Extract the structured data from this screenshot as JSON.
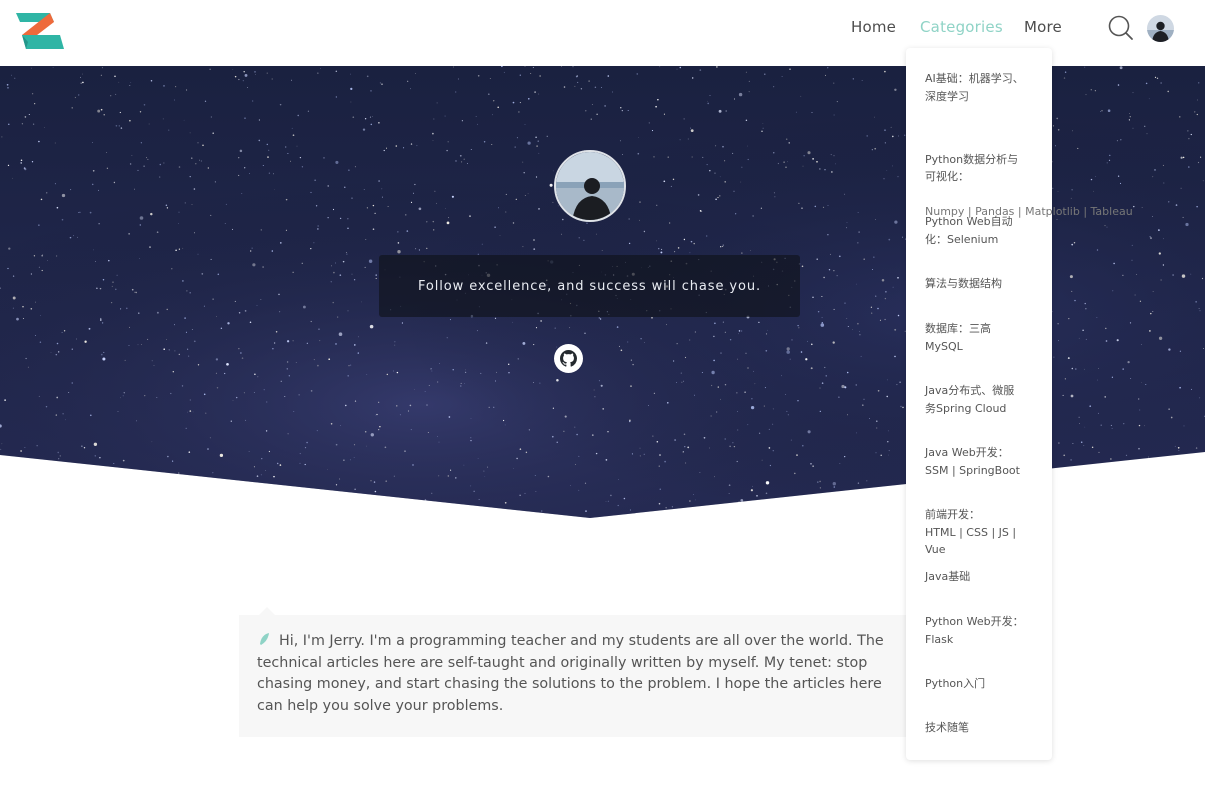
{
  "header": {
    "nav": [
      {
        "label": "Home"
      },
      {
        "label": "Categories"
      },
      {
        "label": "More"
      }
    ],
    "active_color": "#8fd3c6"
  },
  "hero": {
    "motto": "Follow excellence, and success will chase you."
  },
  "categories_menu": [
    {
      "label": "AI基础：机器学习、\n深度学习"
    },
    {
      "label": "Python数据分析与\n可视化：",
      "sub": "Numpy | Pandas | Matplotlib | Tableau"
    },
    {
      "label": "Python Web自动\n化：Selenium"
    },
    {
      "label": "算法与数据结构"
    },
    {
      "label": "数据库：三高\nMySQL"
    },
    {
      "label": "Java分布式、微服\n务Spring Cloud"
    },
    {
      "label": "Java Web开发：\nSSM | SpringBoot"
    },
    {
      "label": "前端开发：\nHTML | CSS | JS | Vue"
    },
    {
      "label": "Java基础"
    },
    {
      "label": "Python Web开发：\nFlask"
    },
    {
      "label": "Python入门"
    },
    {
      "label": "技术随笔"
    }
  ],
  "intro": {
    "text": "Hi, I'm Jerry. I'm a programming teacher and my students are all over the world. The technical articles here are self-taught and originally written by myself. My tenet: stop chasing money, and start chasing the solutions to the problem. I hope the articles here can help you solve your problems."
  }
}
